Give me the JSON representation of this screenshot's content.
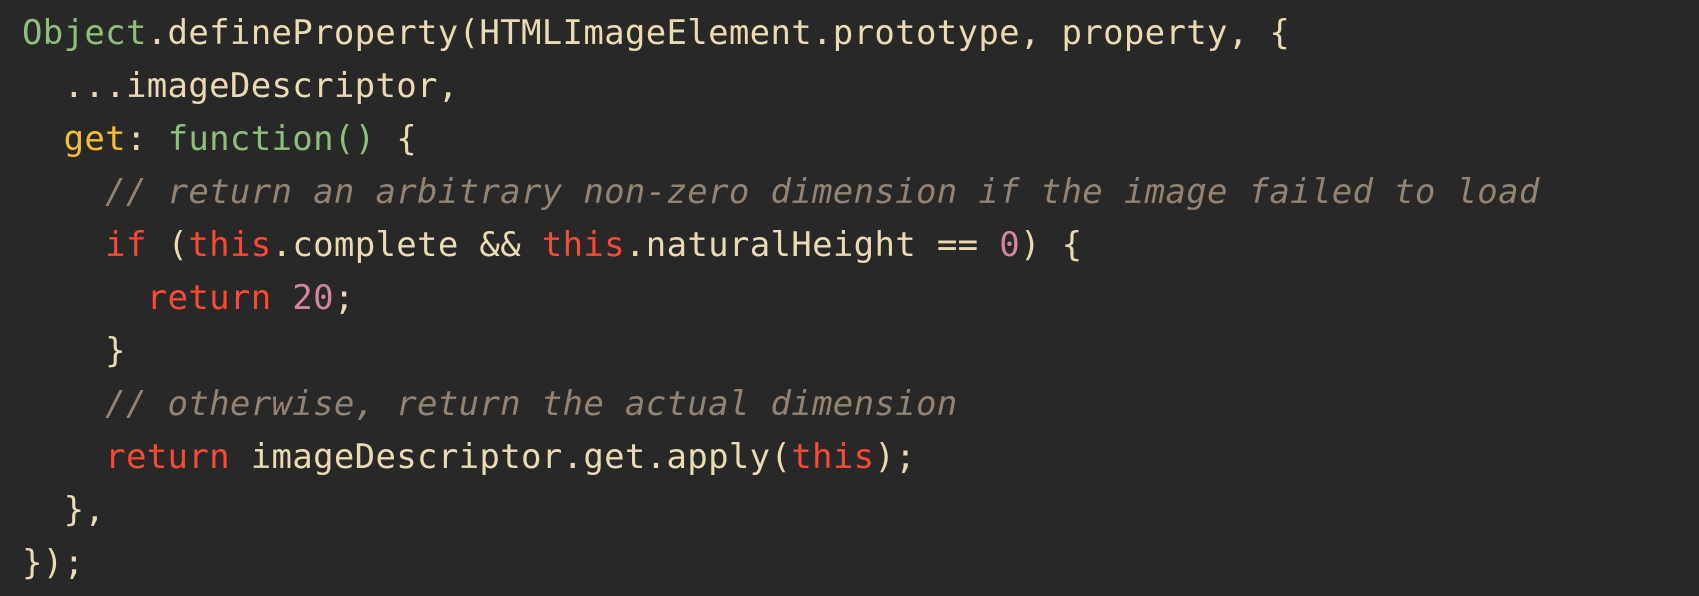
{
  "editor": {
    "background": "#282828",
    "lines": [
      {
        "indent": 0,
        "tokens": [
          {
            "text": "Object",
            "type": "object"
          },
          {
            "text": ".defineProperty(HTMLImageElement.prototype, property, {",
            "type": "plain"
          }
        ]
      },
      {
        "indent": 2,
        "tokens": [
          {
            "text": "...imageDescriptor,",
            "type": "plain"
          }
        ]
      },
      {
        "indent": 2,
        "tokens": [
          {
            "text": "get",
            "type": "property"
          },
          {
            "text": ": ",
            "type": "plain"
          },
          {
            "text": "function()",
            "type": "function"
          },
          {
            "text": " {",
            "type": "plain"
          }
        ]
      },
      {
        "indent": 4,
        "tokens": [
          {
            "text": "// return an arbitrary non-zero dimension if the image failed to load",
            "type": "comment"
          }
        ]
      },
      {
        "indent": 4,
        "tokens": [
          {
            "text": "if",
            "type": "keyword"
          },
          {
            "text": " (",
            "type": "plain"
          },
          {
            "text": "this",
            "type": "this"
          },
          {
            "text": ".complete && ",
            "type": "plain"
          },
          {
            "text": "this",
            "type": "this"
          },
          {
            "text": ".naturalHeight == ",
            "type": "plain"
          },
          {
            "text": "0",
            "type": "number"
          },
          {
            "text": ") {",
            "type": "plain"
          }
        ]
      },
      {
        "indent": 6,
        "tokens": [
          {
            "text": "return",
            "type": "keyword"
          },
          {
            "text": " ",
            "type": "plain"
          },
          {
            "text": "20",
            "type": "number"
          },
          {
            "text": ";",
            "type": "plain"
          }
        ]
      },
      {
        "indent": 4,
        "tokens": [
          {
            "text": "}",
            "type": "plain"
          }
        ]
      },
      {
        "indent": 4,
        "tokens": [
          {
            "text": "// otherwise, return the actual dimension",
            "type": "comment"
          }
        ]
      },
      {
        "indent": 4,
        "tokens": [
          {
            "text": "return",
            "type": "keyword"
          },
          {
            "text": " imageDescriptor.get.apply(",
            "type": "plain"
          },
          {
            "text": "this",
            "type": "this"
          },
          {
            "text": ");",
            "type": "plain"
          }
        ]
      },
      {
        "indent": 2,
        "tokens": [
          {
            "text": "},",
            "type": "plain"
          }
        ]
      },
      {
        "indent": 0,
        "tokens": [
          {
            "text": "});",
            "type": "plain"
          }
        ]
      }
    ]
  }
}
